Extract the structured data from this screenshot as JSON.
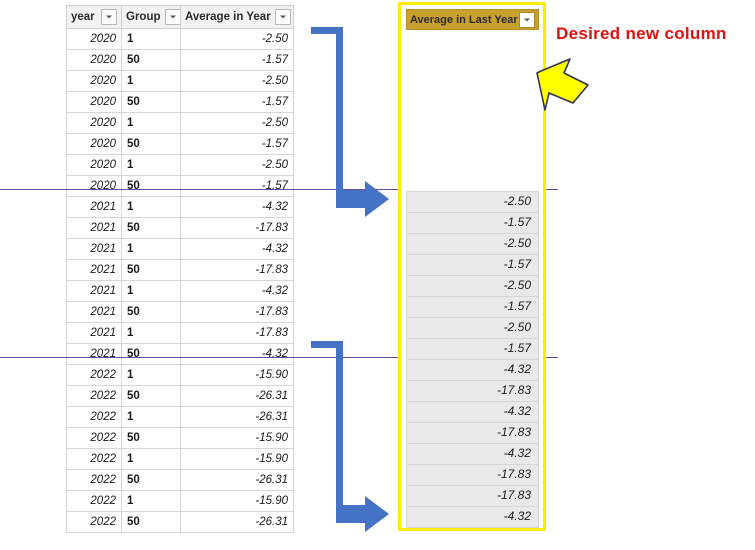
{
  "source_table": {
    "name": "source-data-table",
    "columns": [
      {
        "key": "year",
        "label": "year",
        "filter_icon": "filter-dropdown-icon"
      },
      {
        "key": "group",
        "label": "Group",
        "filter_icon": "filter-dropdown-icon"
      },
      {
        "key": "avg",
        "label": "Average in Year",
        "filter_icon": "filter-dropdown-icon"
      }
    ],
    "rows": [
      {
        "year": "2020",
        "group": "1",
        "avg": "-2.50"
      },
      {
        "year": "2020",
        "group": "50",
        "avg": "-1.57"
      },
      {
        "year": "2020",
        "group": "1",
        "avg": "-2.50"
      },
      {
        "year": "2020",
        "group": "50",
        "avg": "-1.57"
      },
      {
        "year": "2020",
        "group": "1",
        "avg": "-2.50"
      },
      {
        "year": "2020",
        "group": "50",
        "avg": "-1.57"
      },
      {
        "year": "2020",
        "group": "1",
        "avg": "-2.50"
      },
      {
        "year": "2020",
        "group": "50",
        "avg": "-1.57"
      },
      {
        "year": "2021",
        "group": "1",
        "avg": "-4.32"
      },
      {
        "year": "2021",
        "group": "50",
        "avg": "-17.83"
      },
      {
        "year": "2021",
        "group": "1",
        "avg": "-4.32"
      },
      {
        "year": "2021",
        "group": "50",
        "avg": "-17.83"
      },
      {
        "year": "2021",
        "group": "1",
        "avg": "-4.32"
      },
      {
        "year": "2021",
        "group": "50",
        "avg": "-17.83"
      },
      {
        "year": "2021",
        "group": "1",
        "avg": "-17.83"
      },
      {
        "year": "2021",
        "group": "50",
        "avg": "-4.32"
      },
      {
        "year": "2022",
        "group": "1",
        "avg": "-15.90"
      },
      {
        "year": "2022",
        "group": "50",
        "avg": "-26.31"
      },
      {
        "year": "2022",
        "group": "1",
        "avg": "-26.31"
      },
      {
        "year": "2022",
        "group": "50",
        "avg": "-15.90"
      },
      {
        "year": "2022",
        "group": "1",
        "avg": "-15.90"
      },
      {
        "year": "2022",
        "group": "50",
        "avg": "-26.31"
      },
      {
        "year": "2022",
        "group": "1",
        "avg": "-15.90"
      },
      {
        "year": "2022",
        "group": "50",
        "avg": "-26.31"
      }
    ]
  },
  "new_column": {
    "name": "average-in-last-year-column",
    "header_label": "Average in Last Year",
    "filter_icon": "filter-dropdown-icon",
    "header_background": "#c8a02e",
    "highlight_border_color": "#ffeb00",
    "cell_background": "#e9e9e9",
    "blank_row_count": 8,
    "values": [
      "-2.50",
      "-1.57",
      "-2.50",
      "-1.57",
      "-2.50",
      "-1.57",
      "-2.50",
      "-1.57",
      "-4.32",
      "-17.83",
      "-4.32",
      "-17.83",
      "-4.32",
      "-17.83",
      "-17.83",
      "-4.32"
    ]
  },
  "annotation": {
    "name": "desired-new-column-callout",
    "text": "Desired new column",
    "color": "#e01010",
    "arrow_icon": "yellow-down-left-arrow-icon",
    "arrow_fill": "#ffff00",
    "arrow_stroke": "#33334d"
  },
  "connectors": {
    "color": "#4472c4",
    "items": [
      {
        "name": "connector-arrow-2020-to-2021",
        "icon": "blue-elbow-arrow-icon"
      },
      {
        "name": "connector-arrow-2021-to-2022",
        "icon": "blue-elbow-arrow-icon"
      }
    ]
  },
  "year_rules": {
    "name": "year-boundary-rule",
    "color": "#6b4b9b",
    "count": 2
  }
}
